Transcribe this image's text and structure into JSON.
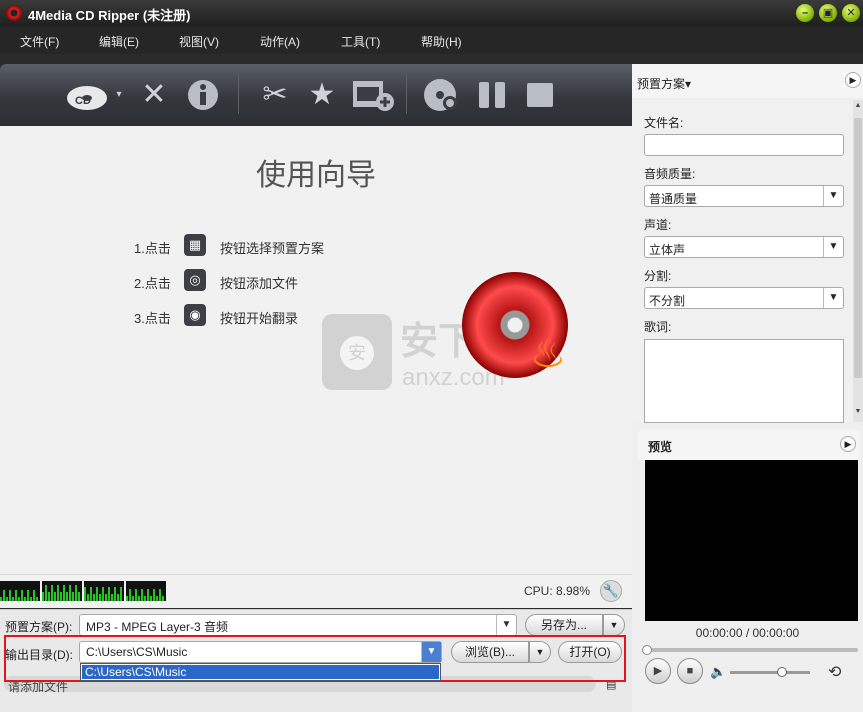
{
  "window": {
    "title": "4Media CD Ripper (未注册)"
  },
  "menu": [
    "文件(F)",
    "编辑(E)",
    "视图(V)",
    "动作(A)",
    "工具(T)",
    "帮助(H)"
  ],
  "toolbar": {
    "icons": [
      "add-cd-icon",
      "delete-icon",
      "info-icon",
      "clip-icon",
      "effects-icon",
      "add-profile-icon",
      "rip-icon",
      "pause-icon",
      "stop-icon"
    ],
    "cd_label": "CD"
  },
  "wizard": {
    "title": "使用向导",
    "steps": [
      {
        "num": "1.点击",
        "icon": "profile-icon",
        "text": "按钮选择预置方案"
      },
      {
        "num": "2.点击",
        "icon": "add-cd-icon",
        "text": "按钮添加文件"
      },
      {
        "num": "3.点击",
        "icon": "rip-icon",
        "text": "按钮开始翻录"
      }
    ]
  },
  "watermark": {
    "text": "安下载",
    "domain": "anxz.com",
    "badge": "安"
  },
  "cpu": {
    "label": "CPU: 8.98%"
  },
  "controls": {
    "preset_label": "预置方案(P):",
    "preset_value": "MP3 - MPEG Layer-3 音频",
    "save_as": "另存为...",
    "output_label": "输出目录(D):",
    "output_value": "C:\\Users\\CS\\Music",
    "dropdown_option": "C:\\Users\\CS\\Music",
    "browse": "浏览(B)...",
    "open": "打开(O)",
    "status": "请添加文件"
  },
  "right_panel": {
    "preset_header": "预置方案",
    "filename_label": "文件名:",
    "filename_value": "",
    "quality_label": "音频质量:",
    "quality_value": "普通质量",
    "channel_label": "声道:",
    "channel_value": "立体声",
    "split_label": "分割:",
    "split_value": "不分割",
    "lyrics_label": "歌词:",
    "preview_header": "预览",
    "time": "00:00:00 / 00:00:00",
    "volume_level": 0.65
  },
  "colors": {
    "highlight_box": "#e0161b",
    "selection": "#2a67c8",
    "toolbar": "#3a3e43"
  }
}
